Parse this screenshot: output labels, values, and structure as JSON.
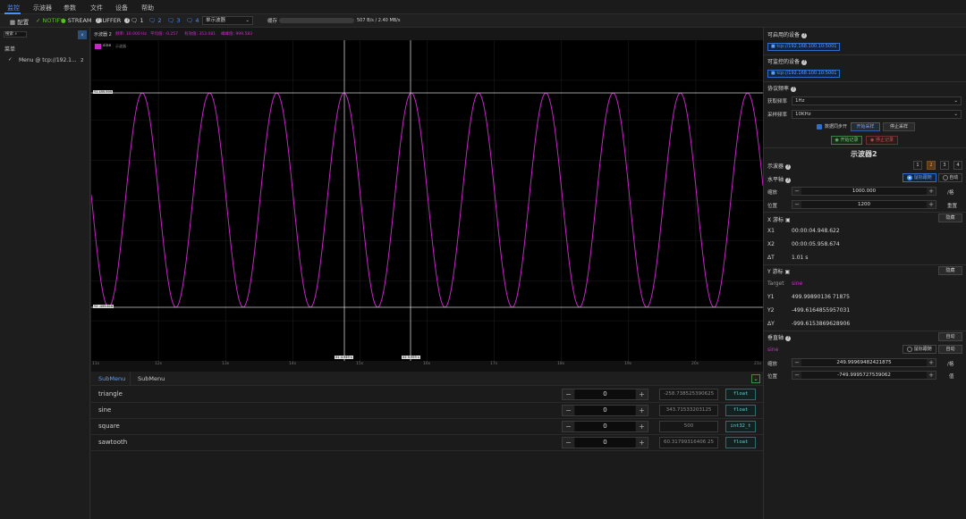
{
  "menu": {
    "items": [
      "监控",
      "示波器",
      "参数",
      "文件",
      "设备",
      "帮助"
    ]
  },
  "toolbar": {
    "config": "配置",
    "notify": "NOTIFY",
    "stream": "STREAM",
    "buffer": "BUFFER",
    "counts": [
      "1",
      "2",
      "3",
      "4"
    ],
    "mode_select": "单示波器",
    "cache_label": "缓存",
    "rate": "507 B/s / 2.40 MB/s"
  },
  "left": {
    "search_placeholder": "搜索",
    "tree_title": "菜单",
    "menu_item": "Menu @ tcp://192.1...",
    "menu_item_count": "2"
  },
  "scope": {
    "title": "示波器 2",
    "stats": [
      "频率: 10.000 Hz",
      "平均值: -0.257",
      "有效值: 353.081",
      "峰峰值: 999.583"
    ],
    "legend": "sine",
    "legend_sub": "示波器",
    "y1_label": "Y1 499.999",
    "y2_label": "Y2 -499.616",
    "x1_label": "X1 4.949 s",
    "x2_label": "X2 5.959 s",
    "xticks": [
      "11s",
      "12s",
      "13s",
      "14s",
      "15s",
      "16s",
      "17s",
      "18s",
      "19s",
      "20s",
      "21s"
    ]
  },
  "submenu": {
    "tabs": [
      "SubMenu",
      "SubMenu"
    ],
    "rows": [
      {
        "name": "triangle",
        "value": "0",
        "current": "-258.738525390625",
        "type": "float"
      },
      {
        "name": "sine",
        "value": "0",
        "current": "343.71533203125",
        "type": "float"
      },
      {
        "name": "square",
        "value": "0",
        "current": "500",
        "type": "int32_t"
      },
      {
        "name": "sawtooth",
        "value": "0",
        "current": "60.31799316406 25",
        "type": "float"
      }
    ]
  },
  "right": {
    "available_devices": "可启用的设备",
    "device1": "tcp://192.168.100.10:5001",
    "monitored_devices": "可监控的设备",
    "device2": "tcp://192.168.100.10:5001",
    "protocol_freq": "协议频率",
    "acq_freq_label": "获取频率",
    "acq_freq": "1Hz",
    "sample_freq_label": "采样频率",
    "sample_freq": "10KHz",
    "sync_check": "数据同步开",
    "start_acq": "开始采样",
    "stop_acq": "停止采样",
    "start_rec": "开始记录",
    "stop_rec": "停止记录",
    "scope_title": "示波器2",
    "scope_label": "示波器",
    "scope_nums": [
      "1",
      "2",
      "3",
      "4"
    ],
    "h_axis": "水平轴",
    "follow_mouse": "鼠标跟随",
    "auto": "自动",
    "scale_label": "缩放",
    "h_scale": "1000.000",
    "h_scale_unit": "/格",
    "pos_label": "位置",
    "h_pos": "1200",
    "h_pos_unit": "重置",
    "x_cursor": "X 游标",
    "hide": "隐藏",
    "x1_label": "X1",
    "x1": "00:00:04.948.622",
    "x2_label": "X2",
    "x2": "00:00:05.958.674",
    "dt_label": "ΔT",
    "dt": "1.01 s",
    "y_cursor": "Y 游标",
    "target_label": "Target",
    "target": "sine",
    "y1_label": "Y1",
    "y1": "499.99890136 71875",
    "y2_label": "Y2",
    "y2": "-499.6164855957031",
    "dy_label": "ΔY",
    "dy": "-999.6153869628906",
    "v_axis": "垂直轴",
    "auto2": "自动",
    "sine": "sine",
    "v_follow": "鼠标跟随",
    "auto3": "自动",
    "v_scale": "249.99969482421875",
    "v_scale_unit": "/格",
    "v_pos": "-749.9995727539062",
    "v_pos_unit": "值"
  }
}
